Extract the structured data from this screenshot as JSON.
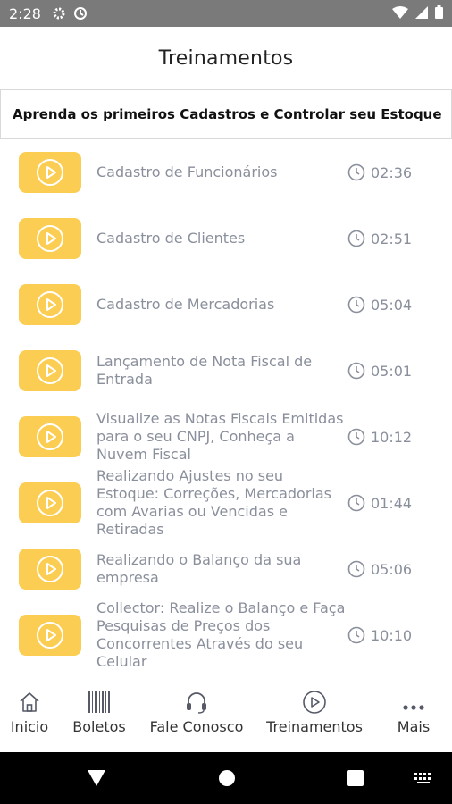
{
  "status_bar": {
    "time": "2:28"
  },
  "header": {
    "title": "Treinamentos"
  },
  "banner": {
    "text": "Aprenda os primeiros Cadastros e Controlar seu Estoque"
  },
  "accent_color": "#fbcd52",
  "videos": [
    {
      "title": "Cadastro de Funcionários",
      "duration": "02:36"
    },
    {
      "title": "Cadastro de Clientes",
      "duration": "02:51"
    },
    {
      "title": "Cadastro de Mercadorias",
      "duration": "05:04"
    },
    {
      "title": "Lançamento de Nota Fiscal de Entrada",
      "duration": "05:01"
    },
    {
      "title": "Visualize as Notas Fiscais Emitidas para o seu CNPJ, Conheça a Nuvem Fiscal",
      "duration": "10:12"
    },
    {
      "title": "Realizando Ajustes no seu Estoque: Correções, Mercadorias com Avarias ou Vencidas e Retiradas",
      "duration": "01:44"
    },
    {
      "title": "Realizando o Balanço da sua empresa",
      "duration": "05:06"
    },
    {
      "title": "Collector: Realize o Balanço e Faça Pesquisas de Preços dos Concorrentes Através do seu Celular",
      "duration": "10:10"
    }
  ],
  "bottom_nav": {
    "items": [
      {
        "label": "Inicio",
        "icon": "home-icon"
      },
      {
        "label": "Boletos",
        "icon": "barcode-icon"
      },
      {
        "label": "Fale Conosco",
        "icon": "headset-icon"
      },
      {
        "label": "Treinamentos",
        "icon": "play-circle-icon"
      },
      {
        "label": "Mais",
        "icon": "more-icon"
      }
    ]
  }
}
